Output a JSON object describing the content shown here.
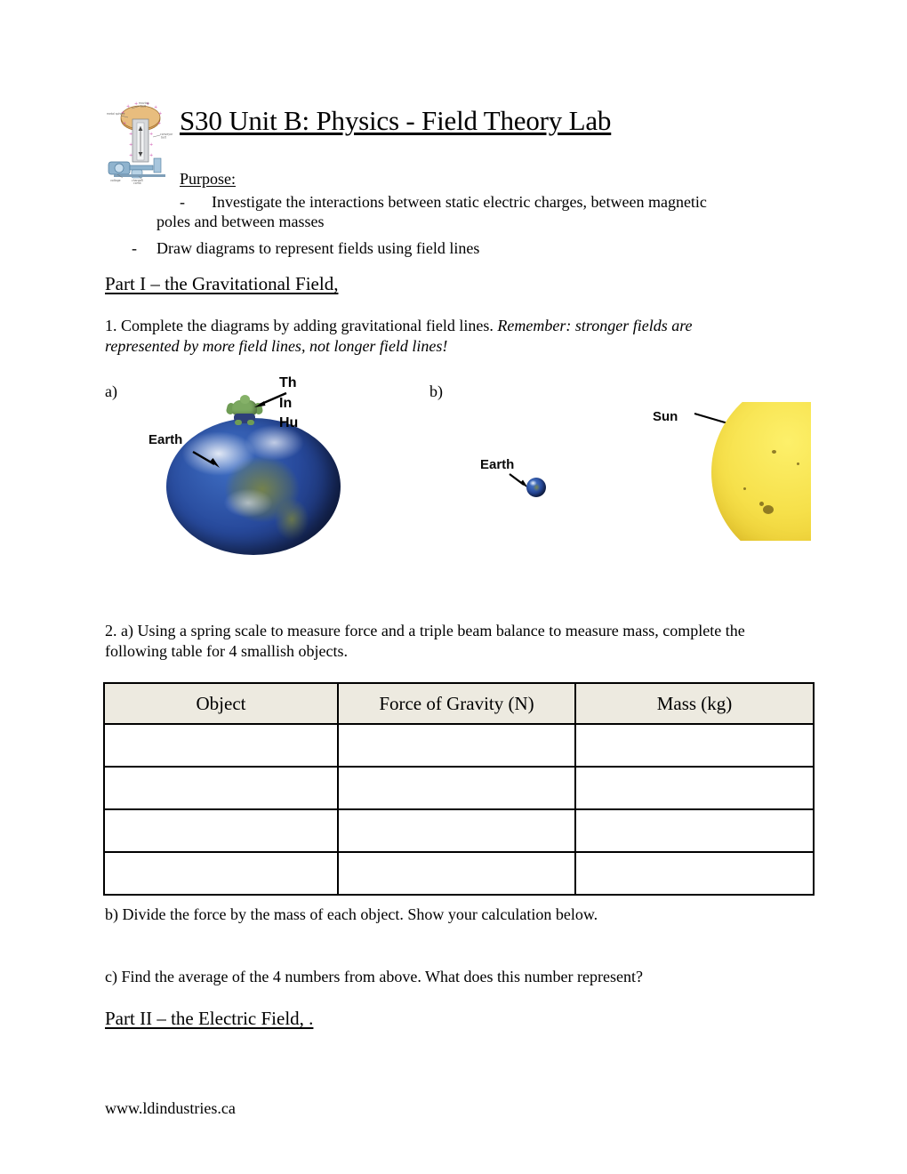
{
  "document": {
    "title": "S30 Unit B: Physics - Field Theory Lab",
    "purpose_label": "Purpose:",
    "purpose_items": [
      {
        "bullet": "-",
        "line1": "Investigate the interactions between static electric charges, between magnetic",
        "line2": "poles and between masses"
      },
      {
        "bullet": "-",
        "line1": "Draw diagrams to represent fields using field lines"
      }
    ],
    "footer": "www.ldindustries.ca"
  },
  "part1": {
    "heading": "Part I – the Gravitational Field, ",
    "q1": {
      "text_normal": "1. Complete the diagrams by adding gravitational field lines. ",
      "text_italic": "Remember: stronger fields are represented by more field lines, not longer field lines!"
    },
    "label_a": "a)",
    "label_b": "b)",
    "figure_a": {
      "name": "earth-and-hulk-diagram",
      "earth_label": "Earth",
      "hulk_caption_lines": [
        "Th",
        "In",
        "Hu"
      ]
    },
    "figure_b": {
      "name": "earth-and-sun-diagram",
      "earth_label": "Earth",
      "sun_label": "Sun"
    },
    "q2a": {
      "line1": "2. a) Using a spring scale to measure force and a triple beam balance to measure mass, complete",
      "line2": "the following table for 4 smallish objects."
    },
    "table": {
      "headers": [
        "Object",
        "Force of Gravity (N)",
        "Mass (kg)"
      ],
      "rows": [
        [
          "",
          "",
          ""
        ],
        [
          "",
          "",
          ""
        ],
        [
          "",
          "",
          ""
        ],
        [
          "",
          "",
          ""
        ]
      ],
      "header_background": "#edeae0",
      "border_color": "#000000"
    },
    "q2b": "b) Divide the force by the mass of each object. Show your calculation below.",
    "q2c": "c) Find the average of the 4 numbers from above. What does this number represent?"
  },
  "part2": {
    "heading": "Part II – the Electric Field, ."
  }
}
